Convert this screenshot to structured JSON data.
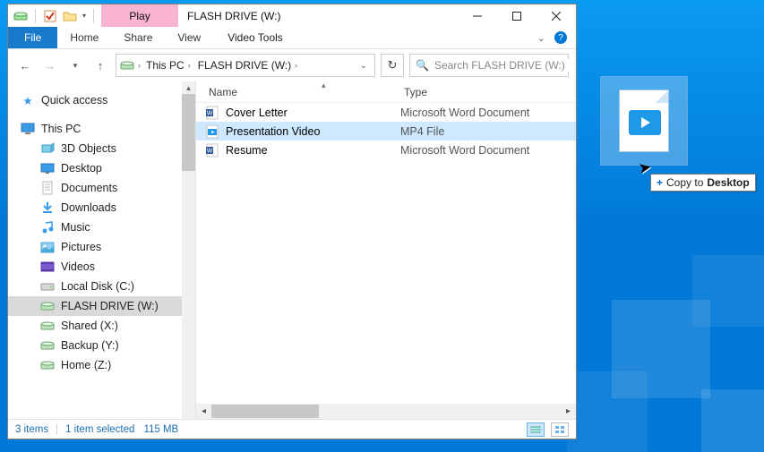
{
  "window": {
    "context_tab": "Play",
    "title": "FLASH DRIVE (W:)",
    "ribbon": {
      "file": "File",
      "home": "Home",
      "share": "Share",
      "view": "View",
      "context": "Video Tools"
    }
  },
  "address": {
    "root": "This PC",
    "loc": "FLASH DRIVE (W:)"
  },
  "search": {
    "placeholder": "Search FLASH DRIVE (W:)"
  },
  "nav": {
    "quick_access": "Quick access",
    "this_pc": "This PC",
    "children": [
      {
        "label": "3D Objects"
      },
      {
        "label": "Desktop"
      },
      {
        "label": "Documents"
      },
      {
        "label": "Downloads"
      },
      {
        "label": "Music"
      },
      {
        "label": "Pictures"
      },
      {
        "label": "Videos"
      },
      {
        "label": "Local Disk (C:)"
      },
      {
        "label": "FLASH DRIVE (W:)"
      },
      {
        "label": "Shared (X:)"
      },
      {
        "label": "Backup (Y:)"
      },
      {
        "label": "Home (Z:)"
      }
    ]
  },
  "columns": {
    "name": "Name",
    "type": "Type"
  },
  "files": [
    {
      "name": "Cover Letter",
      "type": "Microsoft Word Document",
      "kind": "word"
    },
    {
      "name": "Presentation Video",
      "type": "MP4 File",
      "kind": "video",
      "selected": true
    },
    {
      "name": "Resume",
      "type": "Microsoft Word Document",
      "kind": "word"
    }
  ],
  "status": {
    "count": "3 items",
    "selected": "1 item selected",
    "size": "115 MB"
  },
  "drop_hint": {
    "prefix": "Copy to ",
    "dest": "Desktop"
  }
}
